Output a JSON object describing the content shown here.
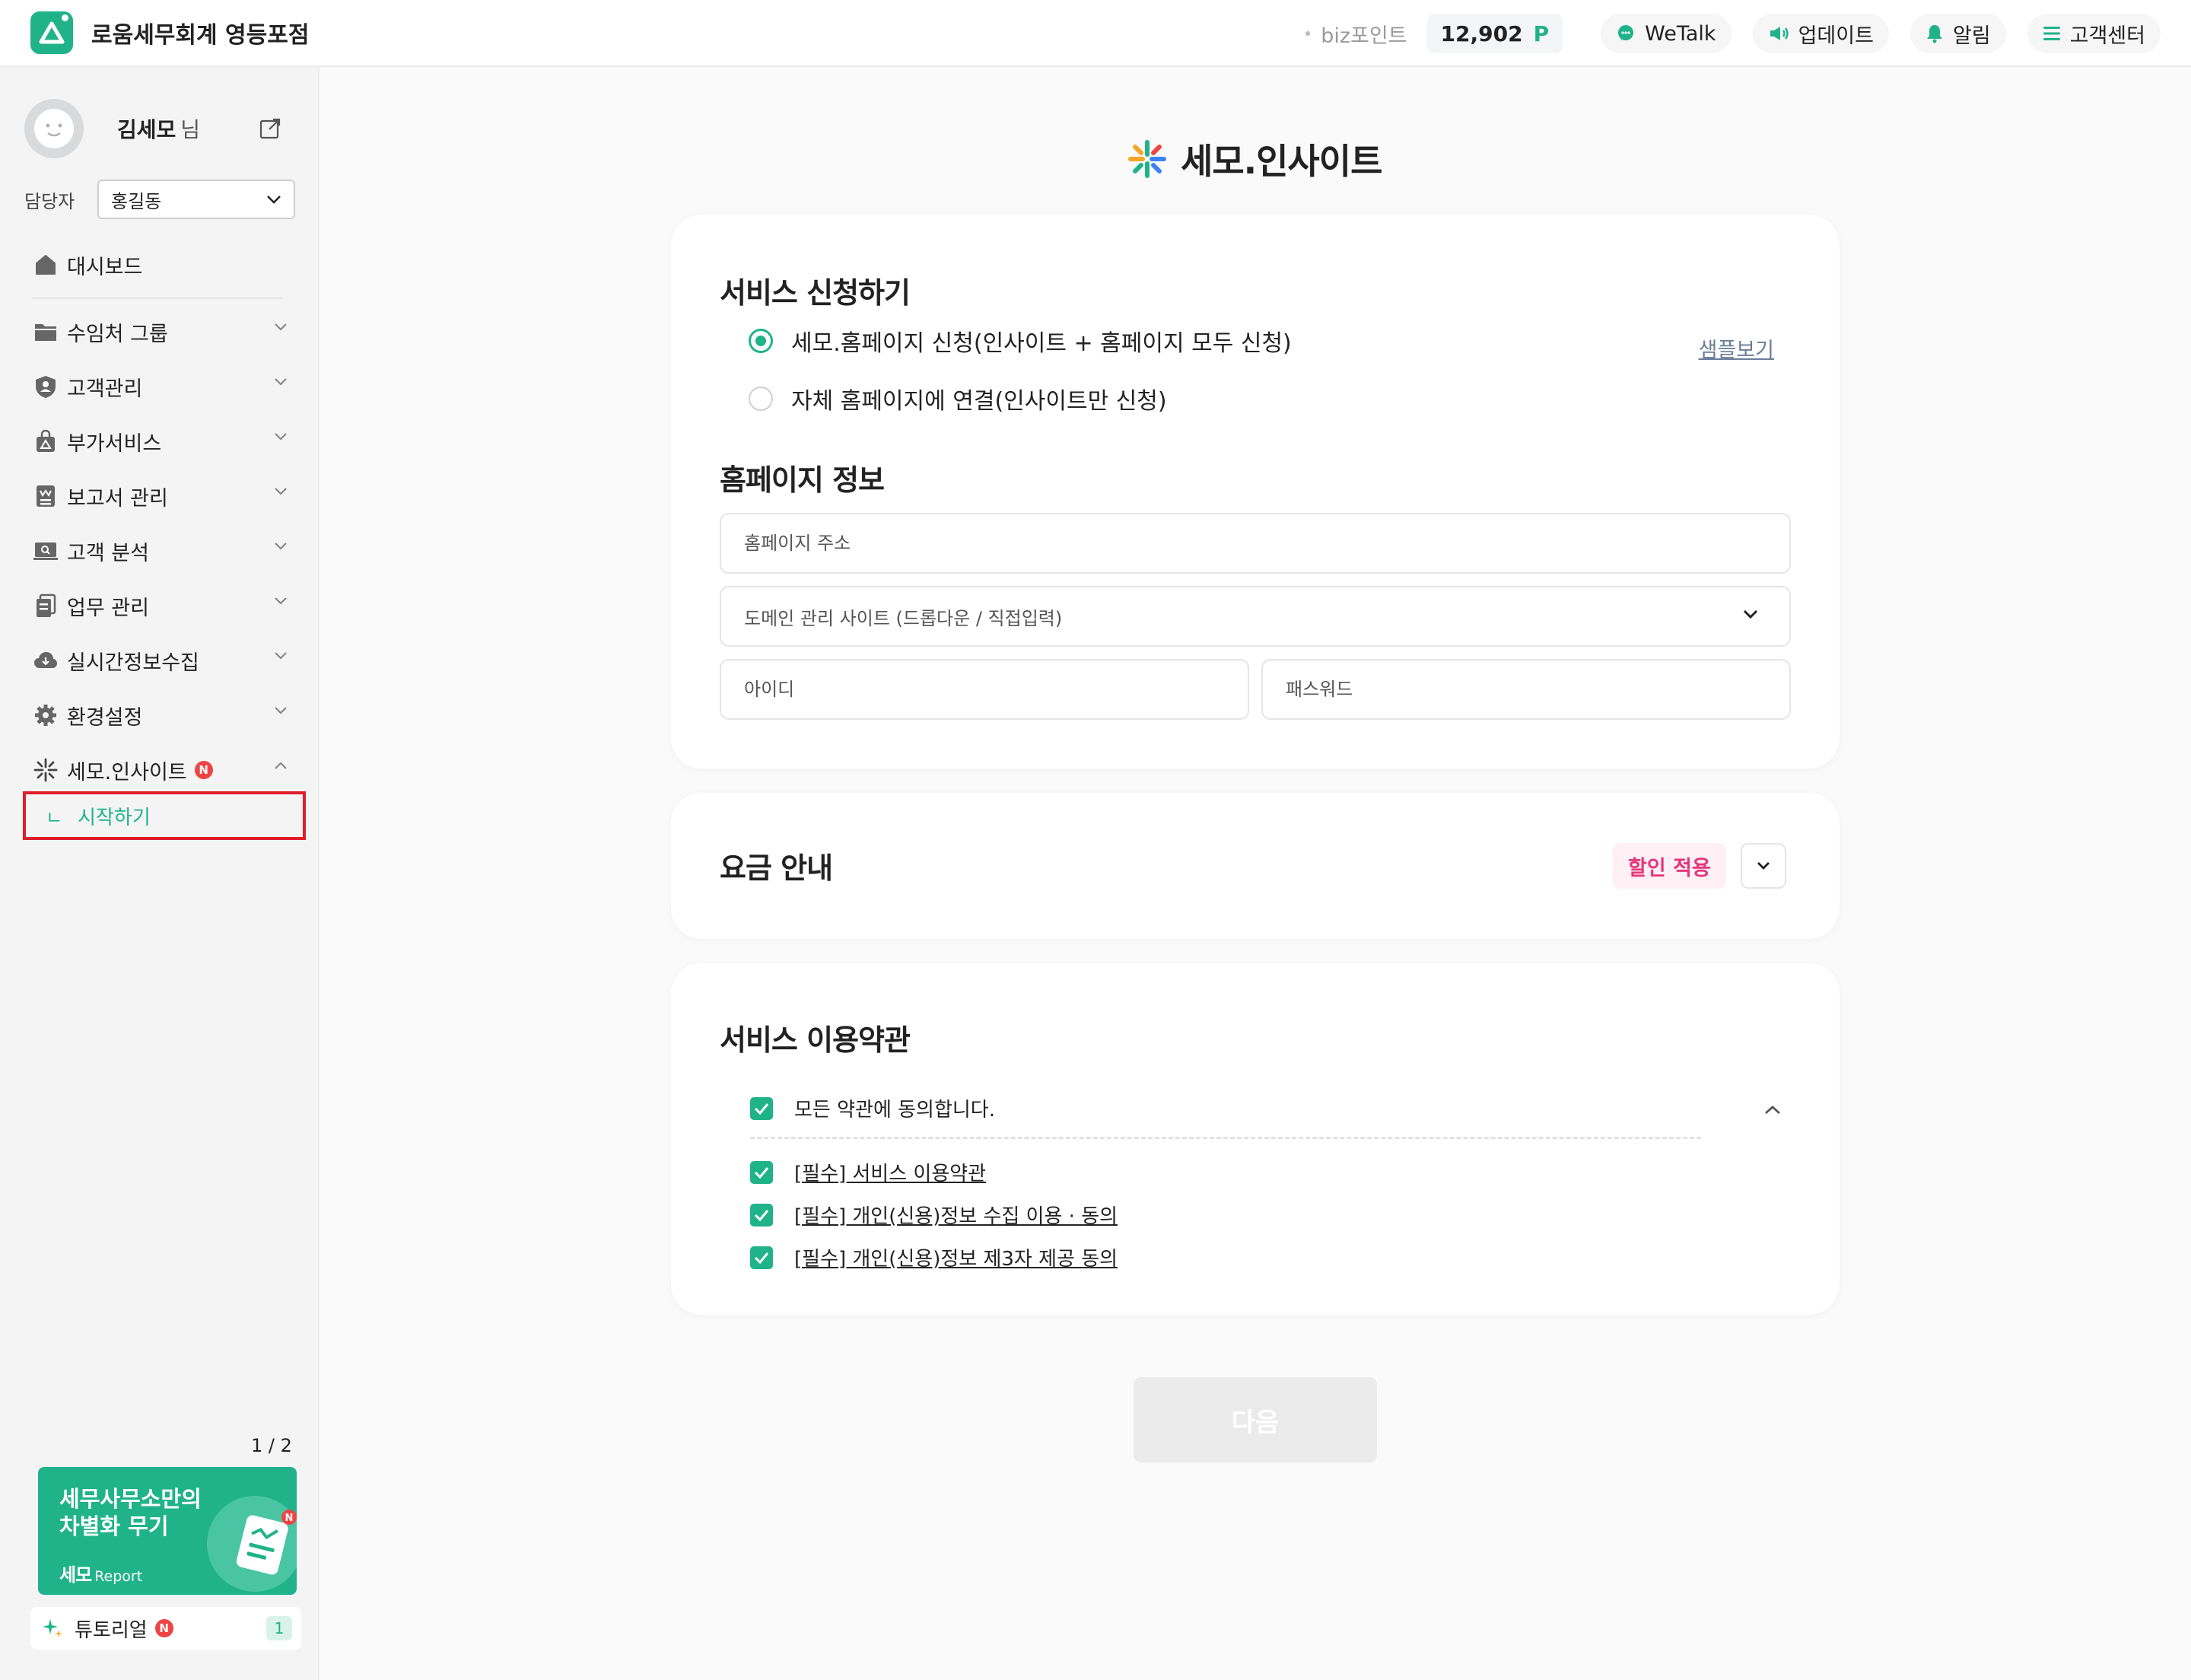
{
  "header": {
    "company_name": "로움세무회계 영등포점",
    "biz_point_label": "biz포인트",
    "point_value": "12,902",
    "point_unit": "P",
    "buttons": [
      {
        "label": "WeTalk",
        "icon": "chat-bubble-icon"
      },
      {
        "label": "업데이트",
        "icon": "megaphone-icon"
      },
      {
        "label": "알림",
        "icon": "bell-icon"
      },
      {
        "label": "고객센터",
        "icon": "hamburger-menu-icon"
      }
    ]
  },
  "sidebar": {
    "user_name": "김세모",
    "user_suffix": "님",
    "manager_label": "담당자",
    "manager_value": "홍길동",
    "items": [
      {
        "label": "대시보드",
        "icon": "home-icon"
      },
      {
        "label": "수임처 그룹",
        "icon": "folder-icon"
      },
      {
        "label": "고객관리",
        "icon": "user-shield-icon"
      },
      {
        "label": "부가서비스",
        "icon": "bag-icon"
      },
      {
        "label": "보고서 관리",
        "icon": "report-icon"
      },
      {
        "label": "고객 분석",
        "icon": "analytics-icon"
      },
      {
        "label": "업무 관리",
        "icon": "document-icon"
      },
      {
        "label": "실시간정보수집",
        "icon": "cloud-download-icon"
      },
      {
        "label": "환경설정",
        "icon": "gear-icon"
      },
      {
        "label": "세모.인사이트",
        "icon": "sparkle-icon",
        "badge": "N"
      }
    ],
    "sub_item": {
      "branch": "ㄴ",
      "label": "시작하기"
    },
    "pager": "1 / 2",
    "promo": {
      "line1": "세무사무소만의",
      "line2": "차별화 무기",
      "brand": "세모",
      "brand_suffix": "Report",
      "badge": "N"
    },
    "tutorial": {
      "label": "튜토리얼",
      "badge": "N",
      "count": "1"
    }
  },
  "main": {
    "title": "세모.인사이트",
    "service_apply": {
      "title": "서비스 신청하기",
      "options": [
        {
          "label": "세모.홈페이지 신청(인사이트 + 홈페이지 모두 신청)",
          "selected": true
        },
        {
          "label": "자체 홈페이지에 연결(인사이트만 신청)",
          "selected": false
        }
      ],
      "sample_link": "샘플보기",
      "homepage_title": "홈페이지 정보",
      "homepage_address_placeholder": "홈페이지 주소",
      "domain_site_placeholder": "도메인 관리 사이트  (드롭다운 / 직접입력)",
      "id_placeholder": "아이디",
      "password_placeholder": "패스워드"
    },
    "pricing": {
      "title": "요금 안내",
      "discount_badge": "할인 적용"
    },
    "terms": {
      "title": "서비스 이용약관",
      "agree_all": "모든 약관에 동의합니다.",
      "items": [
        "[필수] 서비스 이용약관",
        "[필수] 개인(신용)정보 수집 이용 ·  동의",
        "[필수] 개인(신용)정보 제3자 제공 동의"
      ]
    },
    "next_button": "다음"
  },
  "colors": {
    "accent": "#20b38a",
    "highlight_border": "#e11d2a",
    "discount_text": "#e6357a",
    "badge_red": "#ef4444"
  }
}
